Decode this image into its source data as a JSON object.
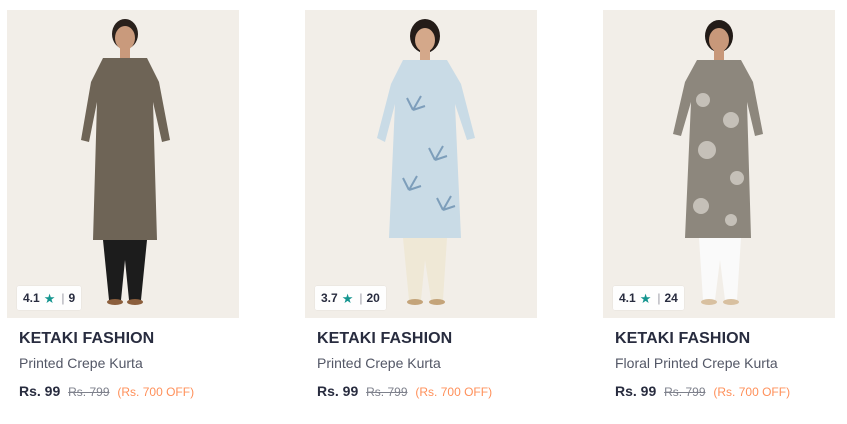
{
  "products": [
    {
      "brand": "KETAKI FASHION",
      "title": "Printed Crepe Kurta",
      "rating": "4.1",
      "rating_count": "9",
      "price": "Rs. 99",
      "mrp": "Rs. 799",
      "discount": "(Rs. 700 OFF)",
      "kurta_color": "#6e6456",
      "bottom_color": "#1c1c1c"
    },
    {
      "brand": "KETAKI FASHION",
      "title": "Printed Crepe Kurta",
      "rating": "3.7",
      "rating_count": "20",
      "price": "Rs. 99",
      "mrp": "Rs. 799",
      "discount": "(Rs. 700 OFF)",
      "kurta_color": "#c9dbe6",
      "bottom_color": "#efe8d6"
    },
    {
      "brand": "KETAKI FASHION",
      "title": "Floral Printed Crepe Kurta",
      "rating": "4.1",
      "rating_count": "24",
      "price": "Rs. 99",
      "mrp": "Rs. 799",
      "discount": "(Rs. 700 OFF)",
      "kurta_color": "#8d877d",
      "bottom_color": "#fafafa"
    }
  ],
  "icons": {
    "rating_star": "star-icon"
  },
  "colors": {
    "rating_star": "#14958f",
    "discount": "#ff905a",
    "brand_text": "#282c3f"
  }
}
